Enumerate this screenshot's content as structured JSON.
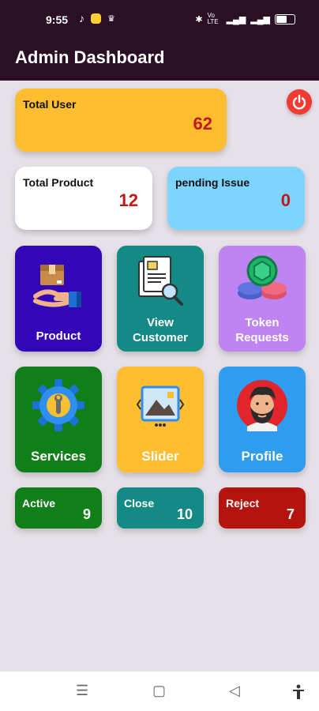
{
  "status_bar": {
    "time": "9:55",
    "left_icons": [
      "music-note-icon",
      "emoji-icon",
      "crown-icon"
    ],
    "right_text": "Vo LTE",
    "battery_level_percent": 60
  },
  "app_bar": {
    "title": "Admin Dashboard"
  },
  "summary": {
    "total_user": {
      "label": "Total User",
      "value": "62"
    },
    "total_product": {
      "label": "Total Product",
      "value": "12"
    },
    "pending_issue": {
      "label": "pending Issue",
      "value": "0"
    }
  },
  "tiles": {
    "product": {
      "label": "Product",
      "icon": "box-in-hand-icon"
    },
    "view_customer": {
      "label_line1": "View",
      "label_line2": "Customer",
      "icon": "document-search-icon"
    },
    "token_requests": {
      "label_line1": "Token",
      "label_line2": "Requests",
      "icon": "coin-stack-icon"
    },
    "services": {
      "label": "Services",
      "icon": "gear-wrench-icon"
    },
    "slider": {
      "label": "Slider",
      "icon": "image-slider-icon"
    },
    "profile": {
      "label": "Profile",
      "icon": "bearded-avatar-icon"
    }
  },
  "stats": {
    "active": {
      "label": "Active",
      "value": "9"
    },
    "close": {
      "label": "Close",
      "value": "10"
    },
    "reject": {
      "label": "Reject",
      "value": "7"
    }
  },
  "nav": {
    "menu": "☰",
    "home": "▢",
    "back": "◁",
    "accessibility": "accessibility-icon"
  },
  "colors": {
    "app_bar": "#2a0f25",
    "background": "#e6e1e8",
    "value_red": "#c01818",
    "power": "#f03b33"
  }
}
